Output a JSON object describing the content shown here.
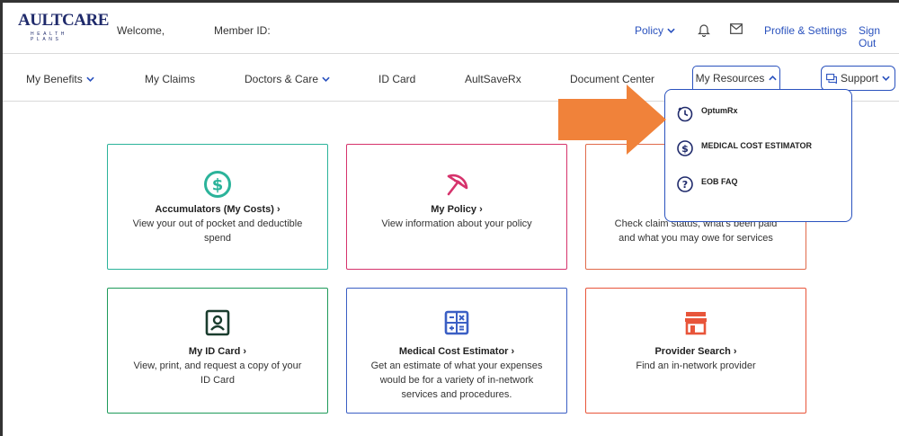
{
  "header": {
    "logo_text": "AULTCARE",
    "logo_sub": "HEALTH PLANS",
    "welcome": "Welcome,",
    "member_id": "Member ID:",
    "policy_label": "Policy",
    "profile_label": "Profile & Settings",
    "signout_label": "Sign Out"
  },
  "nav": {
    "my_benefits": "My Benefits",
    "my_claims": "My Claims",
    "doctors_care": "Doctors & Care",
    "id_card": "ID Card",
    "aultsaverx": "AultSaveRx",
    "document_center": "Document Center",
    "my_resources": "My Resources",
    "support": "Support"
  },
  "dropdown": {
    "items": [
      {
        "label": "OptumRx",
        "icon": "stopwatch-icon"
      },
      {
        "label": "MEDICAL COST ESTIMATOR",
        "icon": "dollar-circle-icon"
      },
      {
        "label": "EOB FAQ",
        "icon": "question-circle-icon"
      }
    ]
  },
  "cards": [
    {
      "title": "Accumulators (My Costs) ›",
      "desc": "View your out of pocket and deductible spend",
      "color": "#2bb39a",
      "icon": "dollar-circle-icon"
    },
    {
      "title": "My Policy ›",
      "desc": "View information about your policy",
      "color": "#d6336c",
      "icon": "umbrella-icon"
    },
    {
      "title": "",
      "desc": "Check claim status, what's been paid and what you may owe for services",
      "color": "#e06a4a",
      "icon": ""
    },
    {
      "title": "My ID Card ›",
      "desc": "View, print, and request a copy of your ID Card",
      "color": "#1e9a5a",
      "icon": "id-card-icon"
    },
    {
      "title": "Medical Cost Estimator ›",
      "desc": "Get an estimate of what your expenses would be for a variety of in-network services and procedures.",
      "color": "#3b5fc4",
      "icon": "calculator-icon"
    },
    {
      "title": "Provider Search ›",
      "desc": "Find an in-network provider",
      "color": "#e8553a",
      "icon": "storefront-icon"
    }
  ],
  "colors": {
    "brand_blue": "#2a52be",
    "arrow_orange": "#f0823a"
  }
}
